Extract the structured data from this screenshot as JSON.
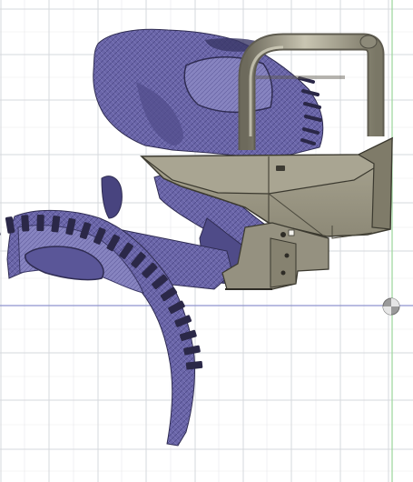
{
  "viewport": {
    "background": "#ffffff",
    "grid_color": "#d6d8dc",
    "axis_x_color": "#8f94cf",
    "axis_y_color": "#9ad69a",
    "show_grid": true
  },
  "scene": {
    "mesh_color": "#6b66a9",
    "mesh_dark": "#2f2c52",
    "mesh_light": "#a9a6d6",
    "bumper_color": "#9b9785",
    "bumper_dark": "#6f6b5c",
    "bumper_light": "#bdb9a6",
    "tube_color": "#a3a08f"
  },
  "icons": {
    "origin_marker": "origin-gizmo-icon"
  }
}
